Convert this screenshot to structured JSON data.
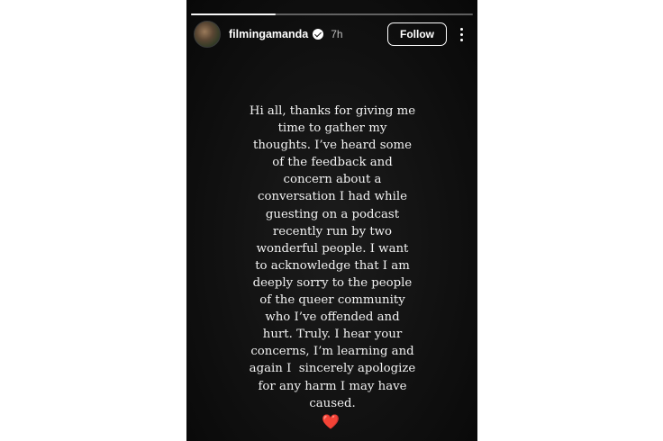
{
  "story": {
    "progress": 0.3,
    "header": {
      "username": "filmingamanda",
      "verified": true,
      "time": "7h",
      "follow_label": "Follow",
      "avatar_icon": "profile-photo",
      "more_icon": "more-vertical-icon"
    },
    "text": "Hi all, thanks for giving me\ntime to gather my\nthoughts. I’ve heard some\nof the feedback and\nconcern about a\nconversation I had while\nguesting on a podcast\nrecently run by two\nwonderful people. I want\nto acknowledge that I am\ndeeply sorry to the people\nof the queer community\nwho I’ve offended and\nhurt. Truly. I hear your\nconcerns, I’m learning and\nagain I  sincerely apologize\nfor any harm I may have\ncaused.",
    "emoji": "❤️",
    "colors": {
      "background": "#111111",
      "text": "#f2f2f2",
      "heart": "#e0202c"
    }
  }
}
